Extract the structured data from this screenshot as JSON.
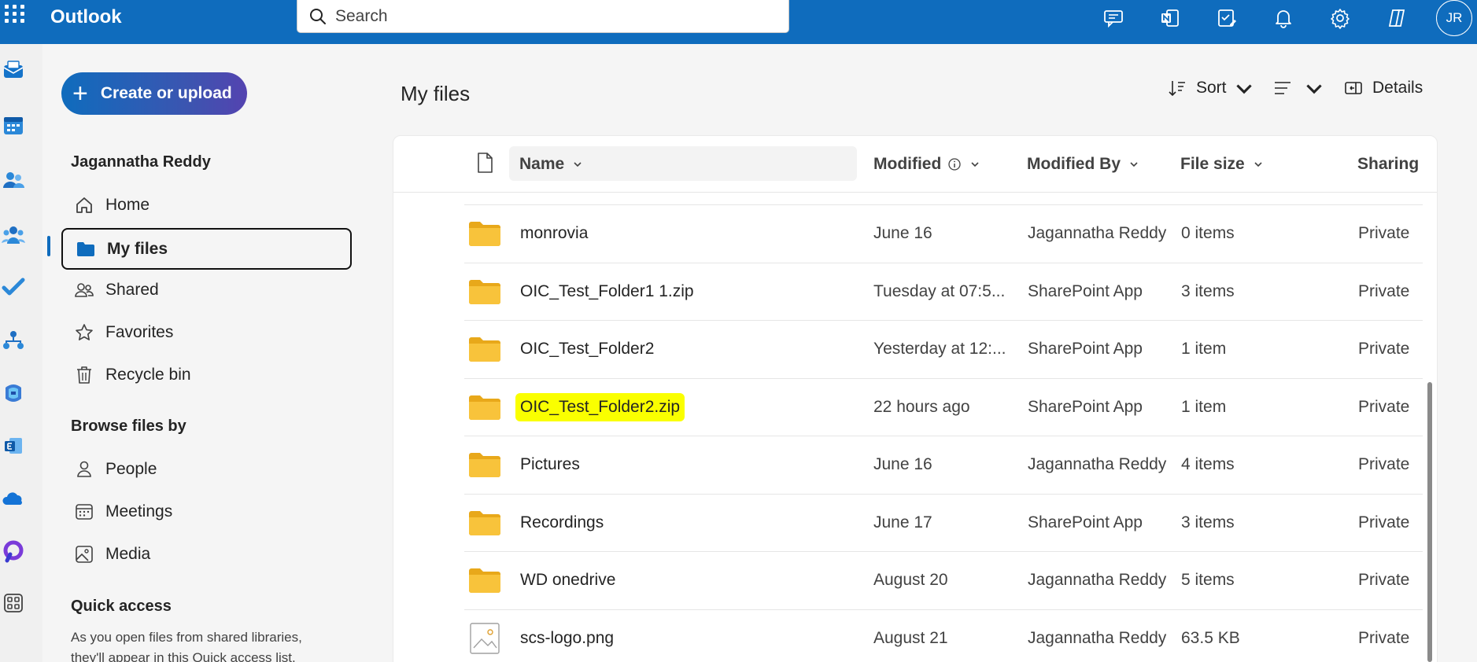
{
  "app": {
    "title": "Outlook",
    "user_initials": "JR"
  },
  "search": {
    "placeholder": "Search"
  },
  "top_icons": [
    "chat-feedback-icon",
    "onenote-icon",
    "todo-icon",
    "bell-icon",
    "gear-icon",
    "copilot-icon"
  ],
  "rail": [
    "mail-icon",
    "calendar-icon",
    "people-icon",
    "groups-icon",
    "todo-check-icon",
    "org-explorer-icon",
    "microsoft-365-icon",
    "exchange-icon",
    "onedrive-icon",
    "viva-icon",
    "more-apps-icon"
  ],
  "sidebar": {
    "create_label": "Create or upload",
    "user_name": "Jagannatha Reddy",
    "items": [
      {
        "label": "Home",
        "icon": "home-icon"
      },
      {
        "label": "My files",
        "icon": "folder-icon",
        "active": true
      },
      {
        "label": "Shared",
        "icon": "shared-people-icon"
      },
      {
        "label": "Favorites",
        "icon": "star-icon"
      },
      {
        "label": "Recycle bin",
        "icon": "trash-icon"
      }
    ],
    "browse_title": "Browse files by",
    "browse_items": [
      {
        "label": "People",
        "icon": "person-icon"
      },
      {
        "label": "Meetings",
        "icon": "calendar-icon"
      },
      {
        "label": "Media",
        "icon": "image-icon"
      }
    ],
    "quick_access_title": "Quick access",
    "quick_access_desc": "As you open files from shared libraries, they'll appear in this Quick access list."
  },
  "main": {
    "title": "My files",
    "sort_label": "Sort",
    "details_label": "Details",
    "columns": {
      "name": "Name",
      "modified": "Modified",
      "modified_by": "Modified By",
      "file_size": "File size",
      "sharing": "Sharing"
    },
    "rows": [
      {
        "type": "folder",
        "name": "monrovia",
        "modified": "June 16",
        "modified_by": "Jagannatha Reddy",
        "size": "0 items",
        "sharing": "Private"
      },
      {
        "type": "folder",
        "name": "OIC_Test_Folder1 1.zip",
        "modified": "Tuesday at 07:5...",
        "modified_by": "SharePoint App",
        "size": "3 items",
        "sharing": "Private"
      },
      {
        "type": "folder",
        "name": "OIC_Test_Folder2",
        "modified": "Yesterday at 12:...",
        "modified_by": "SharePoint App",
        "size": "1 item",
        "sharing": "Private"
      },
      {
        "type": "folder",
        "name": "OIC_Test_Folder2.zip",
        "modified": "22 hours ago",
        "modified_by": "SharePoint App",
        "size": "1 item",
        "sharing": "Private",
        "highlighted": true
      },
      {
        "type": "folder",
        "name": "Pictures",
        "modified": "June 16",
        "modified_by": "Jagannatha Reddy",
        "size": "4 items",
        "sharing": "Private"
      },
      {
        "type": "folder",
        "name": "Recordings",
        "modified": "June 17",
        "modified_by": "SharePoint App",
        "size": "3 items",
        "sharing": "Private"
      },
      {
        "type": "folder",
        "name": "WD onedrive",
        "modified": "August 20",
        "modified_by": "Jagannatha Reddy",
        "size": "5 items",
        "sharing": "Private"
      },
      {
        "type": "image",
        "name": "scs-logo.png",
        "modified": "August 21",
        "modified_by": "Jagannatha Reddy",
        "size": "63.5 KB",
        "sharing": "Private"
      }
    ]
  },
  "colors": {
    "brand": "#0f6cbd",
    "highlight": "#faff00",
    "folder": "#f8c33b"
  }
}
